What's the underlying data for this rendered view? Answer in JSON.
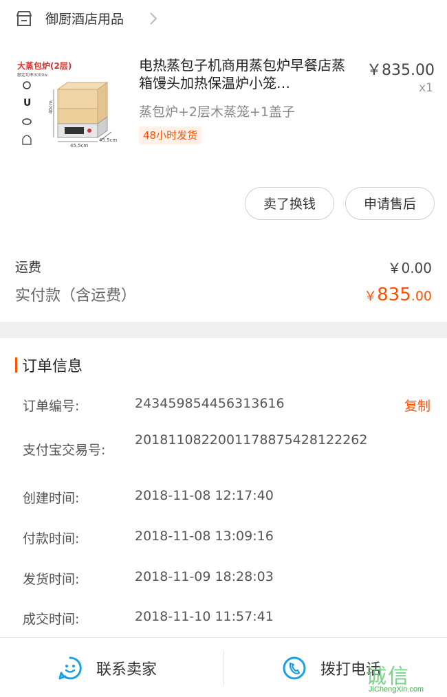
{
  "shop": {
    "name": "御厨酒店用品"
  },
  "product": {
    "image": {
      "title": "大蒸包炉(2层)",
      "subtitle": "额定功率3000w",
      "dims": [
        "40cm",
        "45.5cm",
        "45.5cm"
      ]
    },
    "title": "电热蒸包子机商用蒸包炉早餐店蒸箱馒头加热保温炉小笼…",
    "price": "￥835.00",
    "quantity": "x1",
    "sku": "蒸包炉+2层木蒸笼+1盖子",
    "ship_tag": "48小时发货",
    "actions": {
      "sell": "卖了换钱",
      "after_sale": "申请售后"
    }
  },
  "totals": {
    "shipping_label": "运费",
    "shipping_value": "￥0.00",
    "paid_label": "实付款（含运费）",
    "paid_currency": "￥",
    "paid_integer": "835",
    "paid_decimal": ".00"
  },
  "order_info": {
    "title": "订单信息",
    "copy_label": "复制",
    "rows": [
      {
        "label": "订单编号:",
        "value": "243459854456313616"
      },
      {
        "label": "支付宝交易号:",
        "value": "2018110822001178875428122262"
      },
      {
        "label": "创建时间:",
        "value": "2018-11-08 12:17:40"
      },
      {
        "label": "付款时间:",
        "value": "2018-11-08 13:09:16"
      },
      {
        "label": "发货时间:",
        "value": "2018-11-09 18:28:03"
      },
      {
        "label": "成交时间:",
        "value": "2018-11-10 11:57:41"
      }
    ]
  },
  "bottom_bar": {
    "contact_seller": "联系卖家",
    "call_phone": "拨打电话"
  },
  "watermark": {
    "text": "诚信",
    "url": "JiChengXin.com"
  },
  "colors": {
    "accent": "#ff5000",
    "icon_blue": "#1aa0e8"
  }
}
